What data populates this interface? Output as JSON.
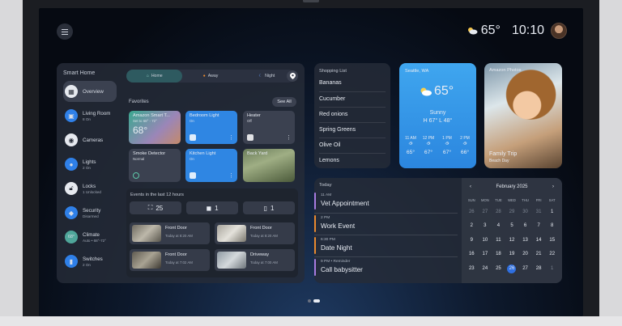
{
  "status_bar": {
    "temperature": "65°",
    "time": "10:10"
  },
  "smart_home": {
    "title": "Smart Home",
    "nav": [
      {
        "label": "Overview",
        "sub": ""
      },
      {
        "label": "Living Room",
        "sub": "8 On"
      },
      {
        "label": "Cameras",
        "sub": ""
      },
      {
        "label": "Lights",
        "sub": "2 On"
      },
      {
        "label": "Locks",
        "sub": "1 Unlocked"
      },
      {
        "label": "Security",
        "sub": "Disarmed"
      },
      {
        "label": "Climate",
        "sub": "Auto • 68°-72°",
        "badge": "68°"
      },
      {
        "label": "Switches",
        "sub": "2 On"
      }
    ],
    "modes": [
      "Home",
      "Away",
      "Night"
    ],
    "favorites_label": "Favorites",
    "see_all": "See All",
    "tiles": [
      {
        "title": "Amazon Smart T...",
        "sub": "Set to 68° - 72°",
        "value": "68°"
      },
      {
        "title": "Bedroom Light",
        "sub": "On"
      },
      {
        "title": "Heater",
        "sub": "Off"
      },
      {
        "title": "Smoke Detector",
        "sub": "Normal"
      },
      {
        "title": "Kitchen Light",
        "sub": "On"
      },
      {
        "title": "Back Yard",
        "sub": ""
      }
    ],
    "events": {
      "title": "Events in the last 12 hours",
      "counts": [
        "25",
        "1",
        "1"
      ],
      "items": [
        {
          "title": "Front Door",
          "time": "Today at 8:20 AM"
        },
        {
          "title": "Front Door",
          "time": "Today at 8:20 AM"
        },
        {
          "title": "Front Door",
          "time": "Today at 7:02 AM"
        },
        {
          "title": "Driveway",
          "time": "Today at 7:00 AM"
        }
      ]
    }
  },
  "shopping_list": {
    "title": "Shopping List",
    "items": [
      "Bananas",
      "Cucumber",
      "Red onions",
      "Spring Greens",
      "Olive Oil",
      "Lemons"
    ]
  },
  "weather": {
    "city": "Seattle, WA",
    "temp": "65°",
    "condition": "Sunny",
    "high_low": "H 67° L 48°",
    "hours": [
      {
        "time": "11 AM",
        "temp": "65°"
      },
      {
        "time": "12 PM",
        "temp": "67°"
      },
      {
        "time": "1 PM",
        "temp": "67°"
      },
      {
        "time": "2 PM",
        "temp": "66°"
      }
    ]
  },
  "photos": {
    "title": "Amazon Photos",
    "caption": "Family Trip",
    "sub": "Beach Day"
  },
  "today": {
    "title": "Today",
    "items": [
      {
        "time": "11 AM",
        "title": "Vet Appointment",
        "color": "#a77be0"
      },
      {
        "time": "2 PM",
        "title": "Work Event",
        "color": "#e98a2f"
      },
      {
        "time": "6:30 PM",
        "title": "Date Night",
        "color": "#e98a2f"
      },
      {
        "time": "9 PM • Reminder",
        "title": "Call babysitter",
        "color": "#a77be0"
      }
    ]
  },
  "calendar": {
    "month": "February 2025",
    "dow": [
      "SUN",
      "MON",
      "TUE",
      "WED",
      "THU",
      "FRI",
      "SAT"
    ],
    "days": [
      "26",
      "27",
      "28",
      "29",
      "30",
      "31",
      "1",
      "2",
      "3",
      "4",
      "5",
      "6",
      "7",
      "8",
      "9",
      "10",
      "11",
      "12",
      "13",
      "14",
      "15",
      "16",
      "17",
      "18",
      "19",
      "20",
      "21",
      "22",
      "23",
      "24",
      "25",
      "26",
      "27",
      "28",
      "1"
    ],
    "today_index": 31
  }
}
